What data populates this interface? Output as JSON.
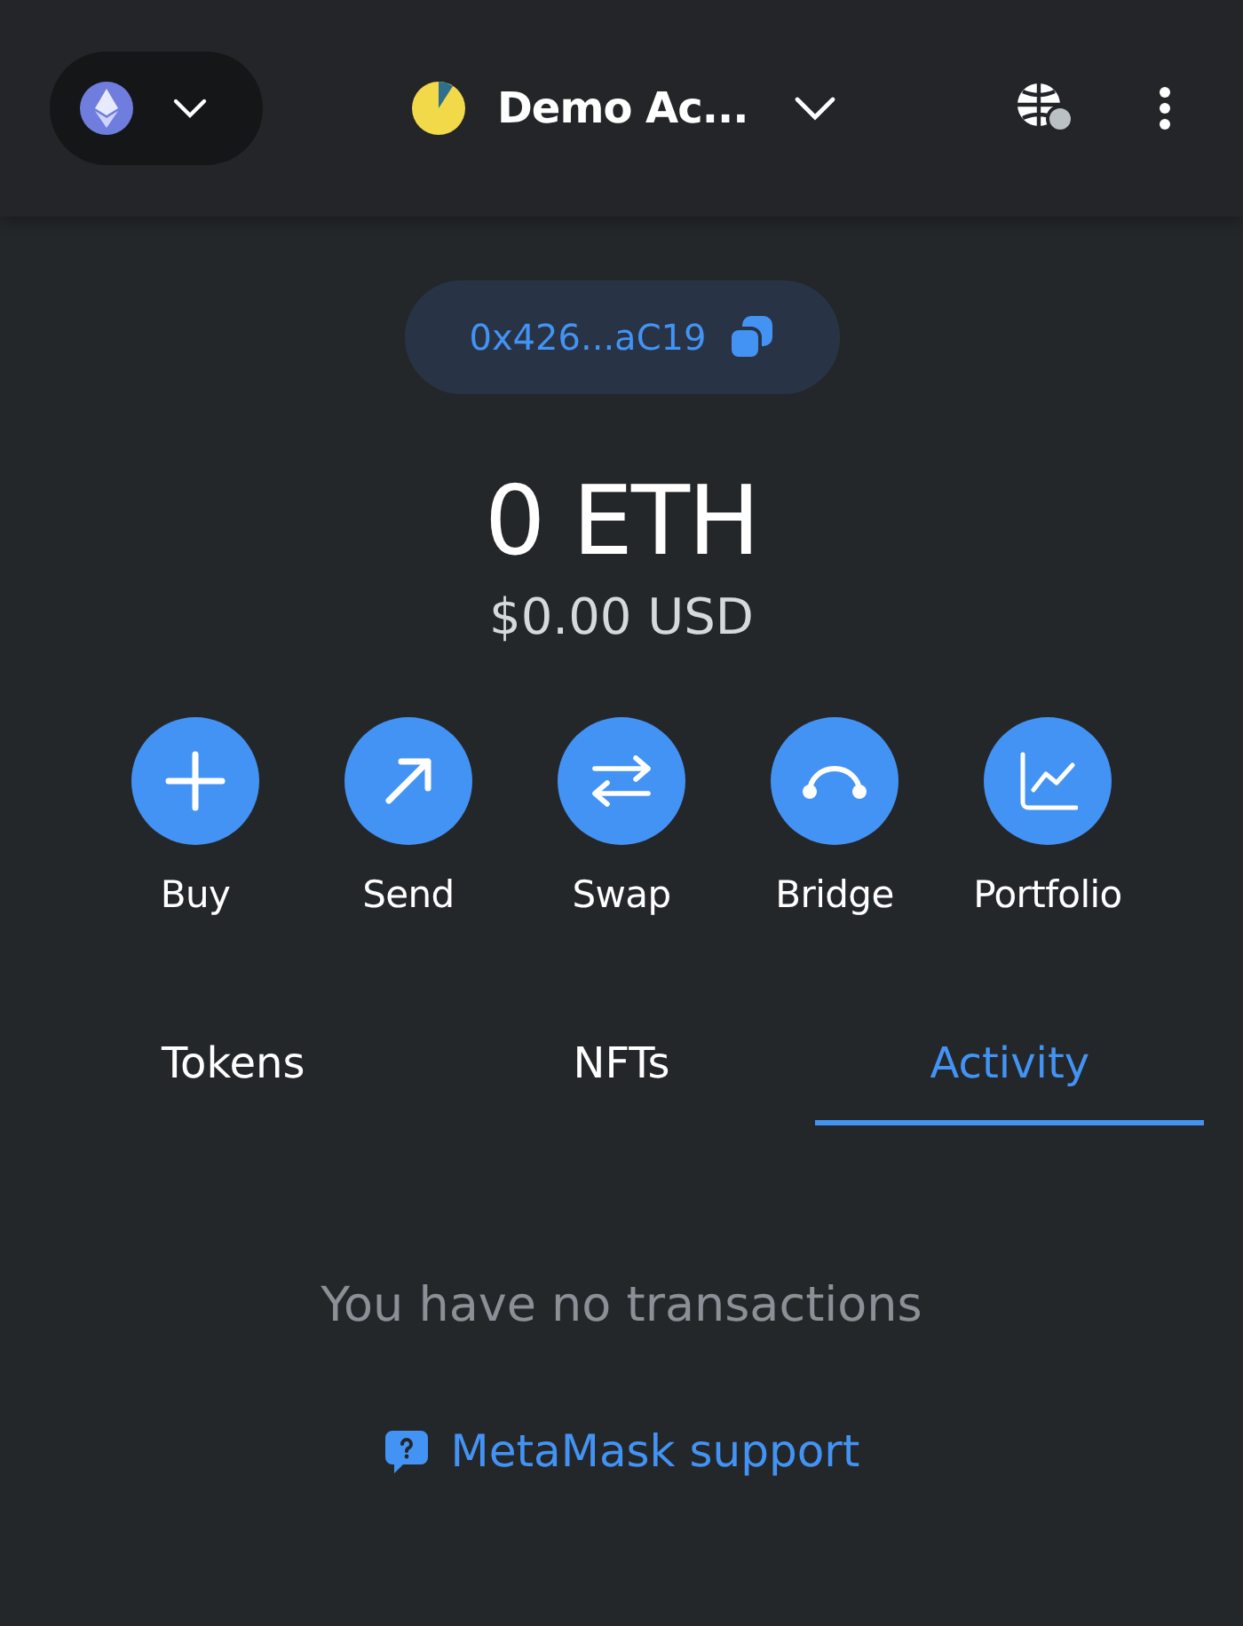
{
  "header": {
    "account_name": "Demo Ac..."
  },
  "address": {
    "text": "0x426...aC19"
  },
  "balance": {
    "primary": "0 ETH",
    "secondary": "$0.00 USD"
  },
  "actions": [
    {
      "label": "Buy"
    },
    {
      "label": "Send"
    },
    {
      "label": "Swap"
    },
    {
      "label": "Bridge"
    },
    {
      "label": "Portfolio"
    }
  ],
  "tabs": [
    {
      "label": "Tokens",
      "selected": false
    },
    {
      "label": "NFTs",
      "selected": false
    },
    {
      "label": "Activity",
      "selected": true
    }
  ],
  "activity": {
    "empty_message": "You have no transactions",
    "support_link": "MetaMask support"
  }
}
